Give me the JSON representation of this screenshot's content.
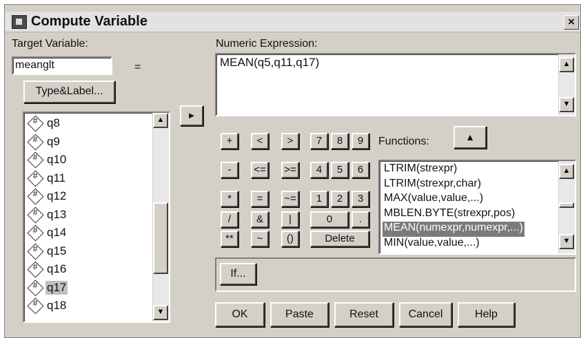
{
  "window": {
    "title": "Compute Variable",
    "close_symbol": "×"
  },
  "target_variable": {
    "label": "Target Variable:",
    "value": "meanglt",
    "equals": "="
  },
  "type_label_button": "Type&Label...",
  "move_arrow": "►",
  "variables": {
    "items": [
      "q8",
      "q9",
      "q10",
      "q11",
      "q12",
      "q13",
      "q14",
      "q15",
      "q16",
      "q17",
      "q18"
    ],
    "selected": "q17"
  },
  "numeric_expression": {
    "label": "Numeric Expression:",
    "value": "MEAN(q5,q11,q17)"
  },
  "keypad": {
    "ops": [
      "+",
      "<",
      ">",
      "-",
      "<=",
      ">=",
      "*",
      "=",
      "~=",
      "/",
      "&",
      "|",
      "**",
      "~",
      "()"
    ],
    "digits": [
      "7",
      "8",
      "9",
      "4",
      "5",
      "6",
      "1",
      "2",
      "3"
    ],
    "zero": "0",
    "dot": ".",
    "delete": "Delete"
  },
  "functions": {
    "label": "Functions:",
    "up_arrow": "▲",
    "items": [
      "LTRIM(strexpr)",
      "LTRIM(strexpr,char)",
      "MAX(value,value,...)",
      "MBLEN.BYTE(strexpr,pos)",
      "MEAN(numexpr,numexpr,...)",
      "MIN(value,value,...)"
    ],
    "selected": "MEAN(numexpr,numexpr,...)"
  },
  "if_button": "If...",
  "buttons": {
    "ok": "OK",
    "paste": "Paste",
    "reset": "Reset",
    "cancel": "Cancel",
    "help": "Help"
  },
  "scroll_arrows": {
    "up": "▲",
    "down": "▼"
  }
}
